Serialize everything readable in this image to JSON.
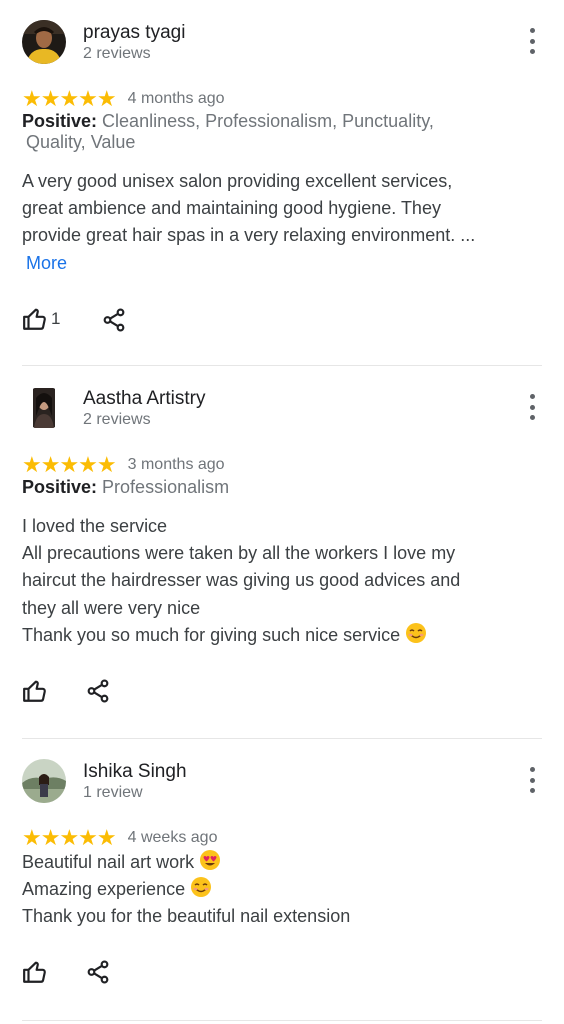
{
  "reviews": [
    {
      "name": "prayas tyagi",
      "review_count": "2 reviews",
      "stars": "★★★★★",
      "date": "4 months ago",
      "positive_label": "Positive:",
      "positive_tags_1": "Cleanliness, Professionalism, Punctuality,",
      "positive_tags_2": "Quality, Value",
      "text_lines": [
        "A very good unisex salon providing excellent services,",
        "great ambience and maintaining good hygiene. They",
        "provide great hair spas in a very relaxing environment. ..."
      ],
      "more_label": "More",
      "likes": "1"
    },
    {
      "name": "Aastha Artistry",
      "review_count": "2 reviews",
      "stars": "★★★★★",
      "date": "3 months ago",
      "positive_label": "Positive:",
      "positive_tags_1": "Professionalism",
      "text_lines": [
        "I loved the service",
        "All precautions were taken by all the workers I love my",
        "haircut the hairdresser was giving us good advices and",
        "they all were very nice",
        "Thank you so much for giving such nice service"
      ],
      "emoji": "smiling-face-emoji"
    },
    {
      "name": "Ishika Singh",
      "review_count": "1 review",
      "stars": "★★★★★",
      "date": "4 weeks ago",
      "text_lines": [
        "Beautiful nail art work",
        "Amazing experience",
        "Thank you for the beautiful nail extension"
      ],
      "emojis": [
        "heart-eyes-emoji",
        "smiling-face-emoji"
      ]
    }
  ],
  "colors": {
    "star": "#fbbc04",
    "link": "#1a73e8",
    "secondary_text": "#70757a",
    "primary_text": "#202124",
    "divider": "#e6e6e6"
  },
  "icons": [
    "thumbs-up-icon",
    "share-icon",
    "more-vert-icon"
  ]
}
